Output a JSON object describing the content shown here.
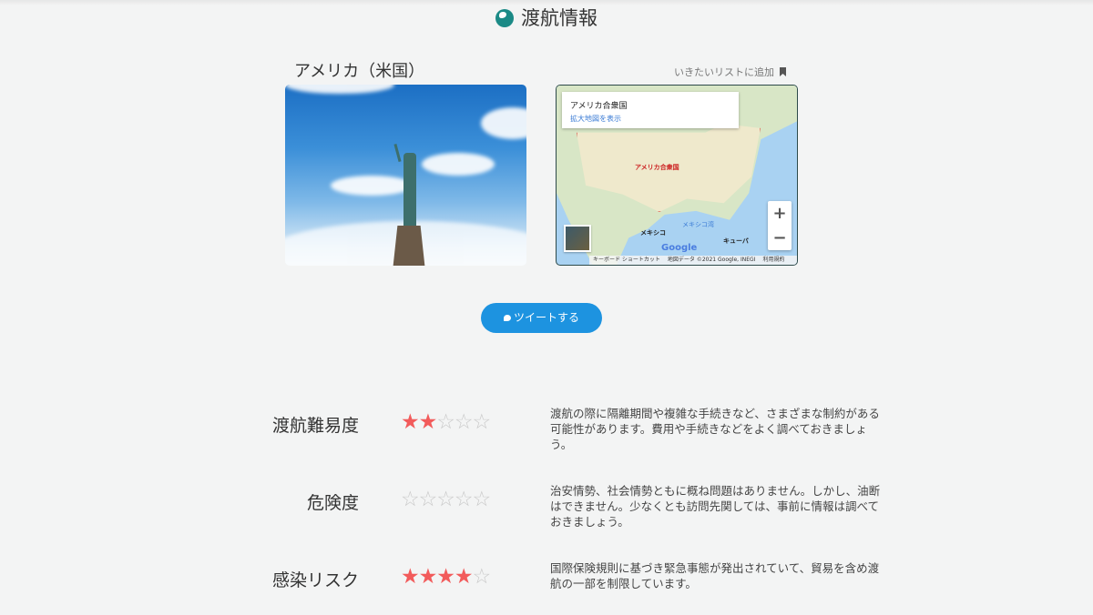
{
  "header": {
    "title": "渡航情報",
    "icon": "globe-icon"
  },
  "destination": {
    "country": "アメリカ（米国）",
    "wishlist_label": "いきたいリストに追加"
  },
  "map": {
    "place_name": "アメリカ合衆国",
    "view_larger": "拡大地図を表示",
    "country_label": "アメリカ合衆国",
    "mexico": "メキシコ",
    "gulf": "メキシコ湾",
    "cuba": "キューバ",
    "zoom_in": "+",
    "zoom_out": "−",
    "logo": "Google",
    "attribution": [
      "キーボード ショートカット",
      "地図データ ©2021 Google, INEGI",
      "利用規約"
    ]
  },
  "tweet": {
    "label": "ツイートする"
  },
  "ratings": [
    {
      "label": "渡航難易度",
      "stars": 2,
      "max": 5,
      "description": "渡航の際に隔離期間や複雑な手続きなど、さまざまな制約がある可能性があります。費用や手続きなどをよく調べておきましょう。"
    },
    {
      "label": "危険度",
      "stars": 0,
      "max": 5,
      "description": "治安情勢、社会情勢ともに概ね問題はありません。しかし、油断はできません。少なくとも訪問先関しては、事前に情報は調べておきましょう。"
    },
    {
      "label": "感染リスク",
      "stars": 4,
      "max": 5,
      "description": "国際保険規則に基づき緊急事態が発出されていて、貿易を含め渡航の一部を制限しています。"
    }
  ],
  "colors": {
    "accent": "#1d93e0",
    "star_on": "#f25b5b",
    "star_off": "#c9c9c9",
    "globe": "#1b8a86"
  }
}
